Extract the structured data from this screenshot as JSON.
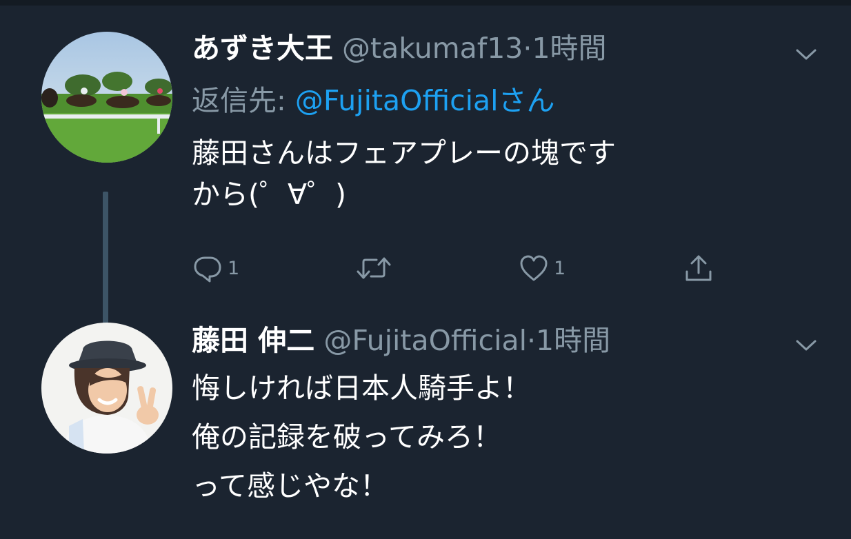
{
  "tweets": [
    {
      "name": "あずき大王",
      "handle": "@takumaf13",
      "separator": "·",
      "time": "1時間",
      "reply_label": "返信先: ",
      "reply_to": "@FujitaOfficialさん",
      "text_lines": [
        "藤田さんはフェアプレーの塊です",
        "から(゜∀゜)"
      ],
      "actions": {
        "reply_count": "1",
        "like_count": "1"
      },
      "avatar_icon": "horse-racing-photo-avatar"
    },
    {
      "name": "藤田 伸二",
      "handle": "@FujitaOfficial",
      "separator": "·",
      "time": "1時間",
      "text_lines": [
        "悔しければ日本人騎手よ！",
        "俺の記録を破ってみろ！",
        "って感じやな！"
      ],
      "avatar_icon": "person-peace-sign-avatar"
    }
  ],
  "colors": {
    "background": "#1b2430",
    "secondary_text": "#8899a6",
    "link": "#1da1f2",
    "thread_line": "#3d5466"
  },
  "icons": [
    "reply-icon",
    "retweet-icon",
    "like-icon",
    "share-icon",
    "chevron-down-icon"
  ]
}
